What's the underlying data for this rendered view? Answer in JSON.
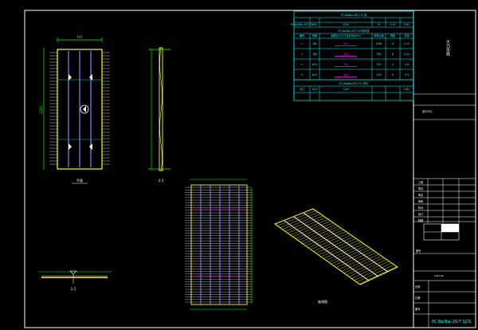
{
  "drawing": {
    "sheet_number": "PC-Ba/Bw-2R/T-32块",
    "views": {
      "plan": "平面",
      "section_a": "2-2",
      "section_b": "1-1",
      "rebar_plan": "",
      "axonometric": "轴测图"
    },
    "dims": {
      "plan_length": "1200",
      "plan_width": "400"
    }
  },
  "schedule": {
    "title_top": "PC-Ba/Bw-2R/T-32 表",
    "title_mid": "PC-Ba/Bw-2R/T-32 材料表",
    "title_bottom": "PC-Ba/Bw-2R/T-32 材料",
    "header": [
      "编号",
      "规格",
      "钢筋加工尺寸及形状(mm)",
      "单根长度",
      "根数",
      "重量"
    ],
    "row_top": [
      "PC-Ba/Bw-2R/T-32",
      "400",
      "1200",
      "32",
      "0.26",
      "0.81"
    ],
    "rows": [
      [
        "①",
        "Φ8",
        "900",
        "1080",
        "12",
        "5.15"
      ],
      [
        "②",
        "Φ8",
        "380",
        "360",
        "8",
        "3.20"
      ],
      [
        "③",
        "Φ10",
        "380",
        "220",
        "4",
        "5.8"
      ],
      [
        "④",
        "Φ12",
        "560",
        "450",
        "6",
        "0.9"
      ]
    ],
    "row_bottom": [
      "合计",
      "14.9",
      "0.26",
      "0.81"
    ]
  },
  "title_block": {
    "company": "大力市政",
    "project_line": "设计中心",
    "rows": [
      "工程",
      "项目",
      "审定",
      "审核",
      "校对",
      "设计",
      "制图"
    ],
    "drawing_label": "图号",
    "scale_label": "比例",
    "date_label": "日期",
    "date_value": "2011.05",
    "sheet_label": "图号",
    "sheet_value": "PC-Ba/Bw-2R/T-32块"
  },
  "colors": {
    "background": "#000000",
    "frame": "#ffffff",
    "outline": "#ffff00",
    "rebar": "#8a7fff",
    "table": "#00ffff",
    "accent": "#ff00ff",
    "green": "#00ff00"
  }
}
